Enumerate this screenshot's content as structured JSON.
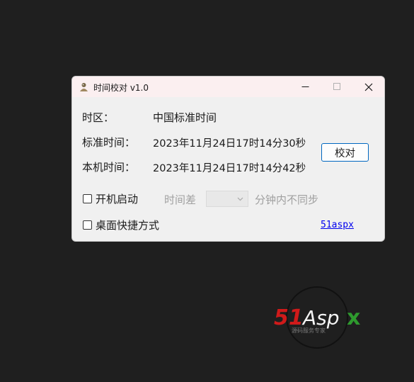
{
  "window": {
    "title": "时间校对 v1.0",
    "controls": {
      "minimize": "minimize-icon",
      "maximize": "maximize-icon",
      "close": "close-icon"
    }
  },
  "rows": {
    "timezone": {
      "label": "时区：",
      "value": "中国标准时间"
    },
    "standard_time": {
      "label": "标准时间：",
      "value": "2023年11月24日17时14分30秒"
    },
    "local_time": {
      "label": "本机时间：",
      "value": "2023年11月24日17时14分42秒"
    }
  },
  "sync_button": "校对",
  "options": {
    "autostart": {
      "label": "开机启动",
      "checked": false
    },
    "shortcut": {
      "label": "桌面快捷方式",
      "checked": false
    },
    "diff_prefix": "时间差",
    "diff_value": "",
    "diff_suffix": "分钟内不同步"
  },
  "link": "51aspx",
  "watermark": {
    "text": "51Aspx",
    "subtext": "源码服务专家"
  },
  "colors": {
    "background": "#1f1f1f",
    "titlebar": "#fbeff0",
    "window": "#f0f0f0",
    "accent": "#0067c0",
    "link": "#0000ee",
    "watermark_red": "#d01a1a",
    "watermark_green": "#2e9a2e"
  }
}
